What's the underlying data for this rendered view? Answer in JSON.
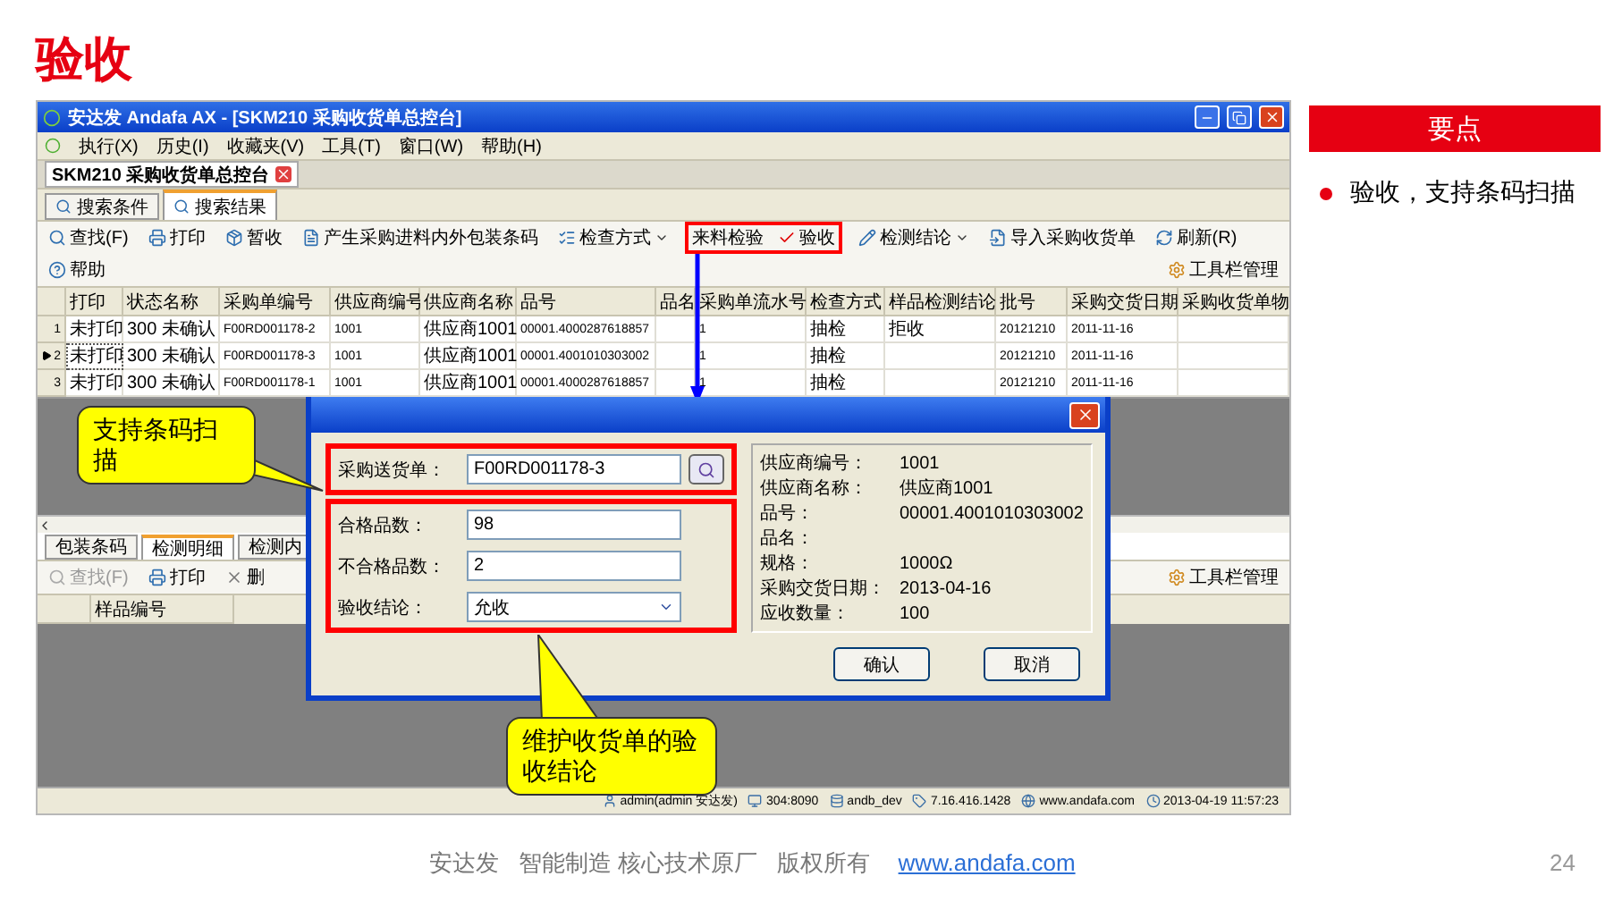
{
  "slide": {
    "title": "验收",
    "page_number": "24"
  },
  "key_points": {
    "heading": "要点",
    "items": [
      "验收，支持条码扫描"
    ]
  },
  "footer": {
    "text": "安达发   智能制造 核心技术原厂   版权所有",
    "link": "www.andafa.com"
  },
  "app": {
    "window_title": "安达发 Andafa AX - [SKM210 采购收货单总控台]",
    "menu": [
      "执行(X)",
      "历史(I)",
      "收藏夹(V)",
      "工具(T)",
      "窗口(W)",
      "帮助(H)"
    ],
    "document_tab": "SKM210 采购收货单总控台",
    "tabs": [
      {
        "label": "搜索条件",
        "selected": false
      },
      {
        "label": "搜索结果",
        "selected": true
      }
    ],
    "toolbar": {
      "items": [
        {
          "label": "查找(F)",
          "kind": "button",
          "highlighted": false
        },
        {
          "label": "打印",
          "kind": "button",
          "highlighted": false
        },
        {
          "label": "暂收",
          "kind": "button",
          "highlighted": false
        },
        {
          "label": "产生采购进料内外包装条码",
          "kind": "button",
          "highlighted": false
        },
        {
          "label": "检查方式",
          "kind": "dropdown",
          "highlighted": false
        },
        {
          "label": "来料检验",
          "kind": "button",
          "highlighted": true
        },
        {
          "label": "验收",
          "kind": "button",
          "highlighted": true
        },
        {
          "label": "检测结论",
          "kind": "dropdown",
          "highlighted": false
        },
        {
          "label": "导入采购收货单",
          "kind": "button",
          "highlighted": false
        },
        {
          "label": "刷新(R)",
          "kind": "button",
          "highlighted": false
        },
        {
          "label": "帮助",
          "kind": "button",
          "highlighted": false
        }
      ],
      "manage": "工具栏管理"
    },
    "grid": {
      "columns": [
        "打印",
        "状态名称",
        "采购单编号",
        "供应商编号",
        "供应商名称",
        "品号",
        "品名",
        "采购单流水号",
        "检查方式",
        "样品检测结论",
        "批号",
        "采购交货日期",
        "采购收货单物"
      ],
      "rows": [
        {
          "number": "1",
          "current": false,
          "cells": [
            "未打印",
            "300 未确认",
            "F00RD001178-2",
            "1001",
            "供应商1001",
            "00001.4000287618857",
            null,
            "1",
            "抽检",
            "拒收",
            "20121210",
            "2011-11-16",
            null
          ]
        },
        {
          "number": "2",
          "current": true,
          "cells": [
            "未打印",
            "300 未确认",
            "F00RD001178-3",
            "1001",
            "供应商1001",
            "00001.4001010303002",
            null,
            "1",
            "抽检",
            null,
            "20121210",
            "2011-11-16",
            null
          ]
        },
        {
          "number": "3",
          "current": false,
          "cells": [
            "未打印",
            "300 未确认",
            "F00RD001178-1",
            "1001",
            "供应商1001",
            "00001.4000287618857",
            null,
            "1",
            "抽检",
            null,
            "20121210",
            "2011-11-16",
            null
          ]
        }
      ]
    },
    "lower_panel": {
      "tabs": [
        {
          "label": "包装条码",
          "selected": false
        },
        {
          "label": "检测明细",
          "selected": true
        },
        {
          "label": "检测内",
          "selected": false
        }
      ],
      "toolbar": [
        {
          "label": "查找(F)",
          "disabled": true
        },
        {
          "label": "打印",
          "disabled": false
        },
        {
          "label": "删",
          "disabled": false
        }
      ],
      "columns": [
        "样品编号"
      ],
      "manage": "工具栏管理"
    },
    "status_bar": [
      "admin(admin 安达发)",
      "304:8090",
      "andb_dev",
      "7.16.416.1428",
      "www.andafa.com",
      "2013-04-19 11:57:23"
    ],
    "dialog": {
      "field_groups": [
        {
          "highlighted": true,
          "fields": [
            {
              "label": "采购送货单：",
              "value": "F00RD001178-3",
              "kind": "lookup"
            }
          ]
        },
        {
          "highlighted": true,
          "fields": [
            {
              "label": "合格品数：",
              "value": "98",
              "kind": "text"
            },
            {
              "label": "不合格品数：",
              "value": "2",
              "kind": "text"
            },
            {
              "label": "验收结论：",
              "value": "允收",
              "kind": "select"
            }
          ]
        }
      ],
      "info": [
        {
          "label": "供应商编号：",
          "value": "1001"
        },
        {
          "label": "供应商名称：",
          "value": "供应商1001"
        },
        {
          "label": "品号：",
          "value": "00001.4001010303002"
        },
        {
          "label": "品名："
        },
        {
          "label": "规格：",
          "value": "1000Ω"
        },
        {
          "label": "采购交货日期：",
          "value": "2013-04-16"
        },
        {
          "label": "应收数量：",
          "value": "100"
        }
      ],
      "buttons": [
        "确认",
        "取消"
      ]
    }
  },
  "callouts": [
    {
      "text": "支持条码扫描"
    },
    {
      "text": "维护收货单的验收结论"
    }
  ]
}
